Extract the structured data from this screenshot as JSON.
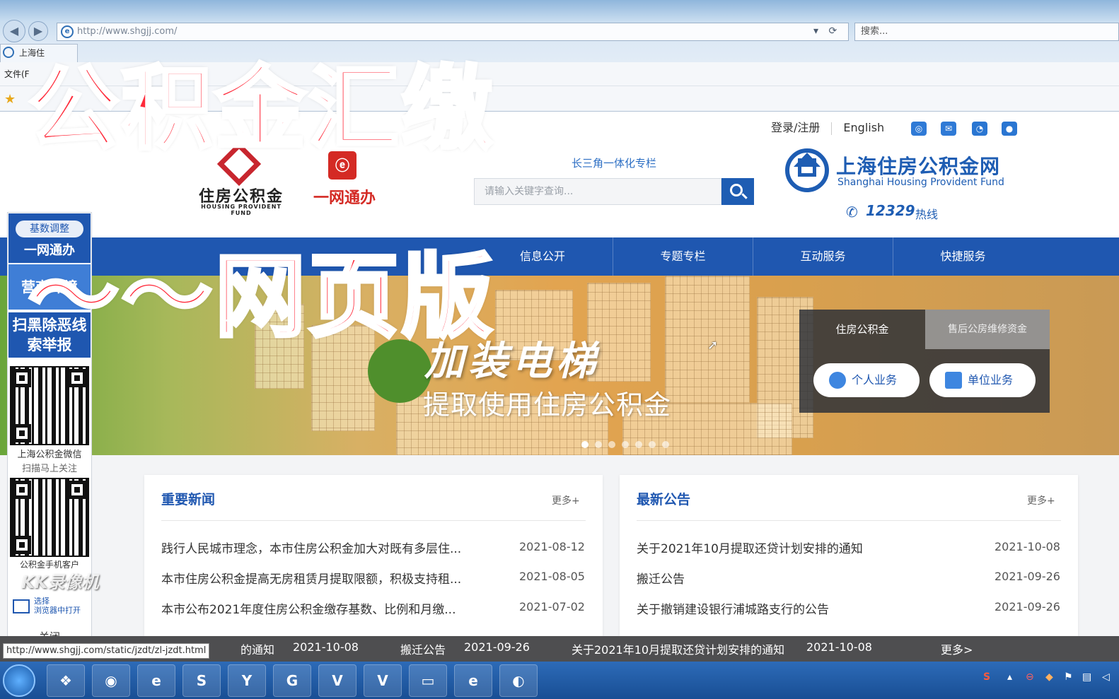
{
  "browser": {
    "url": "http://www.shgjj.com/",
    "search_placeholder": "搜索...",
    "tab_label": "上海住",
    "menu_fragment": "文件(F",
    "tools_glyphs": "▾ ⟳"
  },
  "site": {
    "top_links": [
      "登录/注册",
      "English"
    ],
    "social_icons": [
      "accessibility-icon",
      "mail-icon",
      "weibo-icon",
      "wechat-icon"
    ],
    "logo1_text": "住房公积金",
    "logo1_sub": "HOUSING PROVIDENT FUND",
    "logo2_text": "一网通办",
    "yrd_link": "长三角一体化专栏",
    "search_placeholder": "请输入关键字查询...",
    "brand_cn": "上海住房公积金网",
    "brand_en": "Shanghai Housing Provident Fund",
    "hotline_number": "12329",
    "hotline_label": "热线"
  },
  "nav": {
    "items": [
      "厅",
      "信息公开",
      "专题专栏",
      "互动服务",
      "快捷服务"
    ]
  },
  "banner": {
    "headline": "加装电梯",
    "subline": "提取使用住房公积金",
    "slide_count": 7
  },
  "biz_panel": {
    "tab_active": "住房公积金",
    "tab_inactive": "售后公房维修资金",
    "personal_btn": "个人业务",
    "unit_btn": "单位业务"
  },
  "news": {
    "title": "重要新闻",
    "more": "更多+",
    "items": [
      {
        "title": "践行人民城市理念，本市住房公积金加大对既有多层住...",
        "date": "2021-08-12"
      },
      {
        "title": "本市住房公积金提高无房租赁月提取限额，积极支持租...",
        "date": "2021-08-05"
      },
      {
        "title": "本市公布2021年度住房公积金缴存基数、比例和月缴...",
        "date": "2021-07-02"
      }
    ]
  },
  "notices": {
    "title": "最新公告",
    "more": "更多+",
    "items": [
      {
        "title": "关于2021年10月提取还贷计划安排的通知",
        "date": "2021-10-08"
      },
      {
        "title": "搬迁公告",
        "date": "2021-09-26"
      },
      {
        "title": "关于撤销建设银行浦城路支行的公告",
        "date": "2021-09-26"
      }
    ]
  },
  "float": {
    "pill": "基数调整",
    "yiwang": "一网通办",
    "yingshang": "营商环境",
    "saohei": "扫黑除恶线索举报",
    "qr1_caption1": "上海公积金微信",
    "qr1_caption2": "扫描马上关注",
    "qr2_caption": "公积金手机客户",
    "open_text": "选择\n浏览器中打开",
    "close": "关闭"
  },
  "ticker": {
    "items": [
      "的通知",
      "2021-10-08",
      "搬迁公告",
      "2021-09-26",
      "关于2021年10月提取还贷计划安排的通知",
      "2021-10-08"
    ],
    "more": "更多>"
  },
  "status_bar_url": "http://www.shgjj.com/static/jzdt/zl-jzdt.html",
  "taskbar": {
    "apps": [
      "photo-gallery-icon",
      "chrome-icon",
      "ie-green-icon",
      "sogou-icon",
      "game-icon",
      "pdf-icon",
      "wps-icon",
      "wps2-icon",
      "folder-icon",
      "ie-icon",
      "capture-icon"
    ],
    "app_glyphs": [
      "❖",
      "◉",
      "e",
      "S",
      "Y",
      "G",
      "V",
      "V",
      "▭",
      "e",
      "◐"
    ]
  },
  "overlay": {
    "line1": "公积金汇缴",
    "line2": "～～网页版",
    "watermark": "KK录像机"
  },
  "colors": {
    "primary": "#1f57b0",
    "overlay_red": "#ff2a3a",
    "ticker_bg": "#4e4e50"
  }
}
